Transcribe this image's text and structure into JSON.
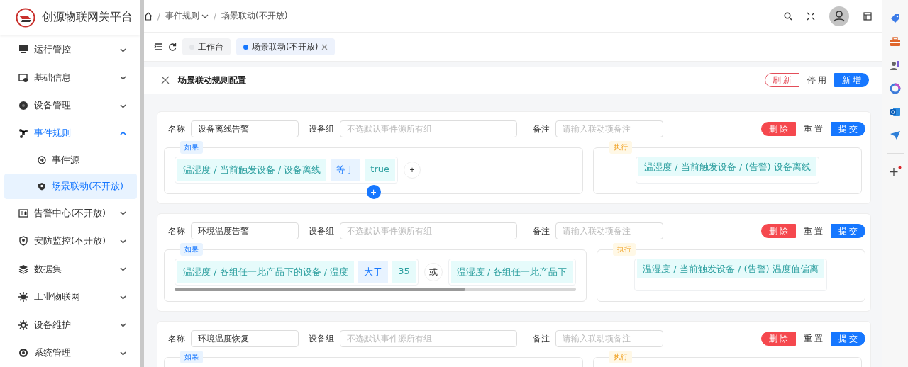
{
  "sidebar": {
    "logo_text": "创源物联网关平台",
    "items": [
      {
        "label": "运行管控",
        "expanded": false
      },
      {
        "label": "基础信息",
        "expanded": false
      },
      {
        "label": "设备管理",
        "expanded": false
      },
      {
        "label": "事件规则",
        "expanded": true,
        "children": [
          {
            "label": "事件源",
            "selected": false
          },
          {
            "label": "场景联动(不开放)",
            "selected": true
          }
        ]
      },
      {
        "label": "告警中心(不开放)",
        "expanded": false
      },
      {
        "label": "安防监控(不开放)",
        "expanded": false
      },
      {
        "label": "数据集",
        "expanded": false
      },
      {
        "label": "工业物联网",
        "expanded": false
      },
      {
        "label": "设备维护",
        "expanded": false
      },
      {
        "label": "系统管理",
        "expanded": false
      }
    ]
  },
  "breadcrumb": [
    {
      "separator": "/",
      "label": "事件规则",
      "dropdown": true
    },
    {
      "separator": "/",
      "label": "场景联动(不开放)",
      "dropdown": false
    }
  ],
  "tabs": [
    {
      "label": "工作台",
      "selected": false,
      "closable": false
    },
    {
      "label": "场景联动(不开放)",
      "selected": true,
      "closable": true
    }
  ],
  "page": {
    "title": "场景联动规则配置",
    "buttons": [
      {
        "label": "刷新",
        "kind": "outline-danger"
      },
      {
        "label": "停用",
        "kind": "plain"
      },
      {
        "label": "新增",
        "kind": "primary"
      }
    ]
  },
  "rules": [
    {
      "fields": [
        {
          "label": "名称",
          "value": "设备离线告警"
        },
        {
          "label": "设备组",
          "placeholder": "不选默认事件源所有组"
        },
        {
          "label": "备注",
          "placeholder": "请输入联动项备注"
        }
      ],
      "buttons": [
        {
          "label": "删除",
          "kind": "danger"
        },
        {
          "label": "重置",
          "kind": "plain"
        },
        {
          "label": "提交",
          "kind": "primary"
        }
      ],
      "condition": {
        "legend": "如果",
        "items": [
          {
            "kind": "clause",
            "path": "温湿度 / 当前触发设备 / 设备离线",
            "operator": "等于",
            "value": "true"
          },
          {
            "kind": "add",
            "label": "+"
          }
        ],
        "add_group": "+"
      },
      "action": {
        "legend": "执行",
        "items": [
          {
            "path": "温湿度 / 当前触发设备 / (告警) 设备离线"
          }
        ]
      }
    },
    {
      "fields": [
        {
          "label": "名称",
          "value": "环境温度告警"
        },
        {
          "label": "设备组",
          "placeholder": "不选默认事件源所有组"
        },
        {
          "label": "备注",
          "placeholder": "请输入联动项备注"
        }
      ],
      "buttons": [
        {
          "label": "删除",
          "kind": "danger"
        },
        {
          "label": "重置",
          "kind": "plain"
        },
        {
          "label": "提交",
          "kind": "primary"
        }
      ],
      "condition": {
        "legend": "如果",
        "items": [
          {
            "kind": "clause",
            "path": "温湿度 / 各组任一此产品下的设备 / 温度",
            "operator": "大于",
            "value": "35"
          },
          {
            "kind": "join",
            "label": "或"
          },
          {
            "kind": "partial",
            "path": "温湿度 / 各组任一此产品下"
          }
        ]
      },
      "action": {
        "legend": "执行",
        "items": [
          {
            "path": "温湿度 / 当前触发设备 / (告警) 温度值偏离"
          }
        ]
      }
    },
    {
      "fields": [
        {
          "label": "名称",
          "value": "环境温度恢复"
        },
        {
          "label": "设备组",
          "placeholder": "不选默认事件源所有组"
        },
        {
          "label": "备注",
          "placeholder": "请输入联动项备注"
        }
      ],
      "buttons": [
        {
          "label": "删除",
          "kind": "danger"
        },
        {
          "label": "重置",
          "kind": "plain"
        },
        {
          "label": "提交",
          "kind": "primary"
        }
      ],
      "condition": {
        "legend": "如果"
      },
      "action": {
        "legend": "执行"
      }
    }
  ]
}
